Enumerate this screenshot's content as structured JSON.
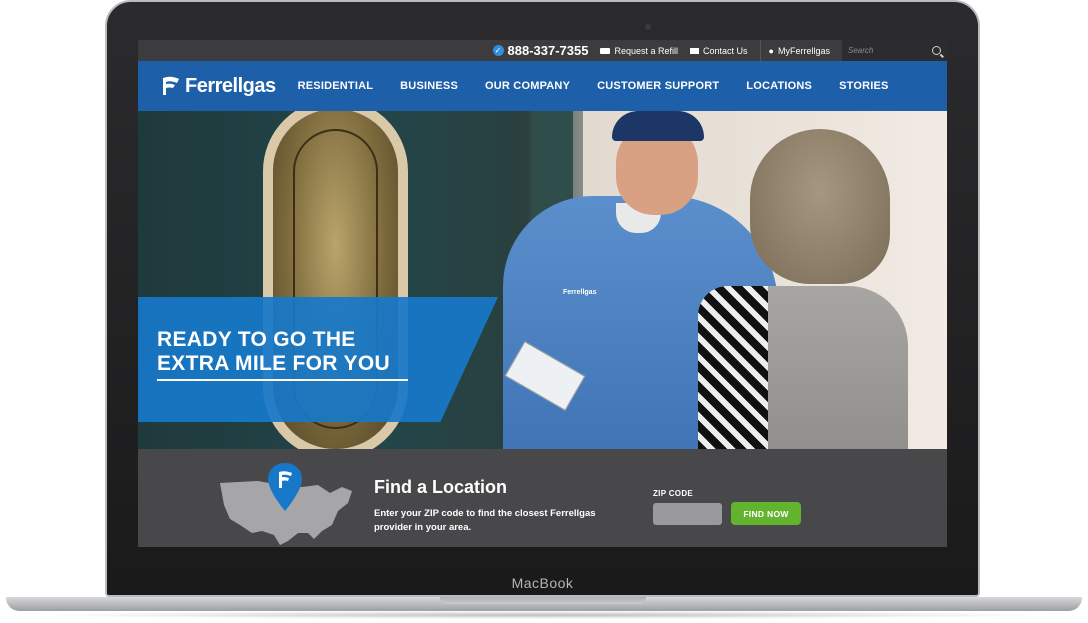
{
  "device": {
    "brand_label": "MacBook"
  },
  "utility_bar": {
    "phone": "888-337-7355",
    "request_refill": "Request a Refill",
    "contact_us": "Contact Us",
    "my_account": "MyFerrellgas",
    "search_placeholder": "Search"
  },
  "nav": {
    "logo": "Ferrellgas",
    "items": [
      "RESIDENTIAL",
      "BUSINESS",
      "OUR COMPANY",
      "CUSTOMER SUPPORT",
      "LOCATIONS",
      "STORIES"
    ]
  },
  "hero": {
    "headline": "READY TO GO THE EXTRA MILE FOR YOU",
    "uniform_logo": "Ferrellgas"
  },
  "locator": {
    "title": "Find a Location",
    "description": "Enter your ZIP code to find the closest Ferrellgas provider in your area.",
    "zip_label": "ZIP CODE",
    "zip_value": "",
    "button_label": "FIND NOW"
  },
  "colors": {
    "brand_blue": "#1d5fa8",
    "banner_blue": "#1778c9",
    "utility_bar": "#3c3c3e",
    "locator_bg": "#48484a",
    "button_green": "#63b32e"
  }
}
